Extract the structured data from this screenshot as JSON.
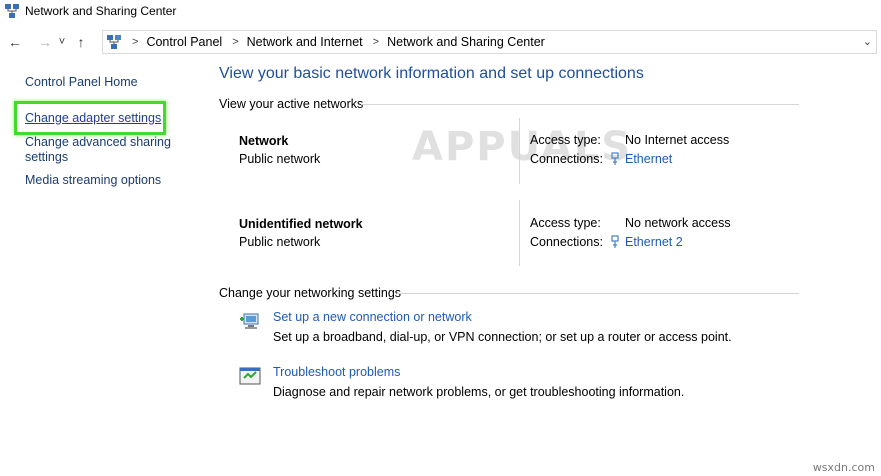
{
  "window": {
    "title": "Network and Sharing Center",
    "icon": "network-icon"
  },
  "nav": {
    "back_icon": "arrow-left-icon",
    "forward_icon": "arrow-right-icon",
    "recent_icon": "chevron-down-icon",
    "up_icon": "arrow-up-icon",
    "back_glyph": "←",
    "forward_glyph": "→",
    "recent_glyph": "˅",
    "up_glyph": "↑"
  },
  "address": {
    "breadcrumbs": [
      "Control Panel",
      "Network and Internet",
      "Network and Sharing Center"
    ],
    "separator": ">",
    "dropdown_glyph": "⌄"
  },
  "left_pane": {
    "items": [
      "Control Panel Home",
      "Change adapter settings",
      "Change advanced sharing settings",
      "Media streaming options"
    ],
    "highlight_color": "#3fdc2e"
  },
  "main": {
    "title": "View your basic network information and set up connections",
    "active_networks_label": "View your active networks",
    "networks": [
      {
        "name": "Network",
        "type": "Public network",
        "access_label": "Access type:",
        "access_value": "No Internet access",
        "connections_label": "Connections:",
        "connection": "Ethernet"
      },
      {
        "name": "Unidentified network",
        "type": "Public network",
        "access_label": "Access type:",
        "access_value": "No network access",
        "connections_label": "Connections:",
        "connection": "Ethernet 2"
      }
    ],
    "settings_label": "Change your networking settings",
    "tasks": [
      {
        "icon": "new-connection-icon",
        "link": "Set up a new connection or network",
        "desc": "Set up a broadband, dial-up, or VPN connection; or set up a router or access point."
      },
      {
        "icon": "troubleshoot-icon",
        "link": "Troubleshoot problems",
        "desc": "Diagnose and repair network problems, or get troubleshooting information."
      }
    ]
  },
  "watermark": {
    "text": "APPUALS",
    "site": "wsxdn.com"
  },
  "colors": {
    "link": "#1e5bb5",
    "title": "#1e4f9c",
    "left_link": "#1c3c70"
  }
}
